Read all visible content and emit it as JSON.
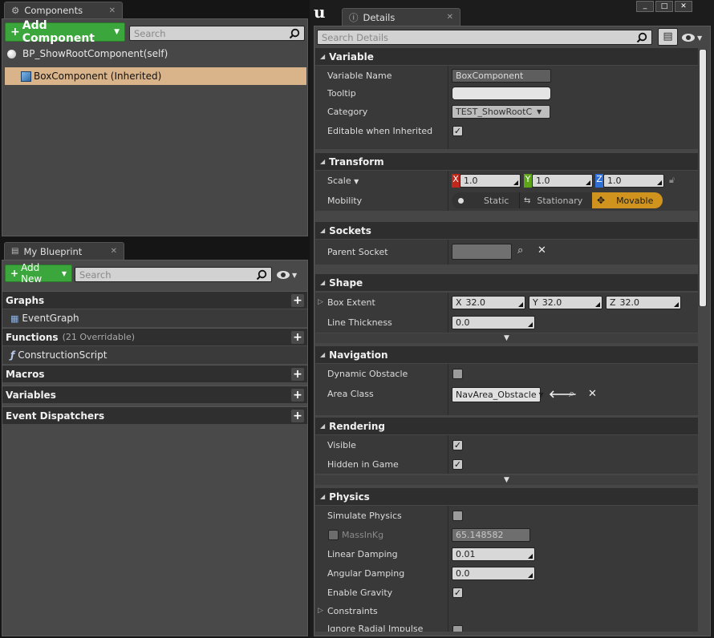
{
  "components": {
    "tab": "Components",
    "add_label": "Add Component",
    "search_placeholder": "Search",
    "root": "BP_ShowRootComponent(self)",
    "child": "BoxComponent (Inherited)"
  },
  "blueprint": {
    "tab": "My Blueprint",
    "add_label": "Add New",
    "search_placeholder": "Search",
    "graphs": "Graphs",
    "event_graph": "EventGraph",
    "functions": "Functions",
    "functions_sub": "(21 Overridable)",
    "construction": "ConstructionScript",
    "macros": "Macros",
    "variables": "Variables",
    "dispatchers": "Event Dispatchers"
  },
  "details": {
    "tab": "Details",
    "search_placeholder": "Search Details",
    "variable": {
      "title": "Variable",
      "name_label": "Variable Name",
      "name_value": "BoxComponent",
      "tooltip_label": "Tooltip",
      "tooltip_value": "",
      "category_label": "Category",
      "category_value": "TEST_ShowRootC",
      "editable_label": "Editable when Inherited",
      "editable": true
    },
    "transform": {
      "title": "Transform",
      "scale_label": "Scale",
      "x_axis": "X",
      "y_axis": "Y",
      "z_axis": "Z",
      "x": "1.0",
      "y": "1.0",
      "z": "1.0",
      "mobility_label": "Mobility",
      "static": "Static",
      "stationary": "Stationary",
      "movable": "Movable",
      "selected": "Movable"
    },
    "sockets": {
      "title": "Sockets",
      "parent_label": "Parent Socket",
      "parent_value": ""
    },
    "shape": {
      "title": "Shape",
      "extent_label": "Box Extent",
      "x_axis": "X",
      "y_axis": "Y",
      "z_axis": "Z",
      "x": "32.0",
      "y": "32.0",
      "z": "32.0",
      "thickness_label": "Line Thickness",
      "thickness": "0.0"
    },
    "navigation": {
      "title": "Navigation",
      "dynamic_label": "Dynamic Obstacle",
      "dynamic": false,
      "area_label": "Area Class",
      "area_value": "NavArea_Obstacle"
    },
    "rendering": {
      "title": "Rendering",
      "visible_label": "Visible",
      "visible": true,
      "hidden_label": "Hidden in Game",
      "hidden": true
    },
    "physics": {
      "title": "Physics",
      "simulate_label": "Simulate Physics",
      "simulate": false,
      "mass_label": "MassInKg",
      "mass": "65.148582",
      "linear_label": "Linear Damping",
      "linear": "0.01",
      "angular_label": "Angular Damping",
      "angular": "0.0",
      "gravity_label": "Enable Gravity",
      "gravity": true,
      "constraints_label": "Constraints",
      "radial_label": "Ignore Radial Impulse"
    }
  },
  "colors": {
    "accent_green": "#3ba63b",
    "selected_row": "#d9b48a",
    "movable": "#d0941e",
    "axis_x": "#c0281c",
    "axis_y": "#5fa51a",
    "axis_z": "#2f6fd6"
  }
}
